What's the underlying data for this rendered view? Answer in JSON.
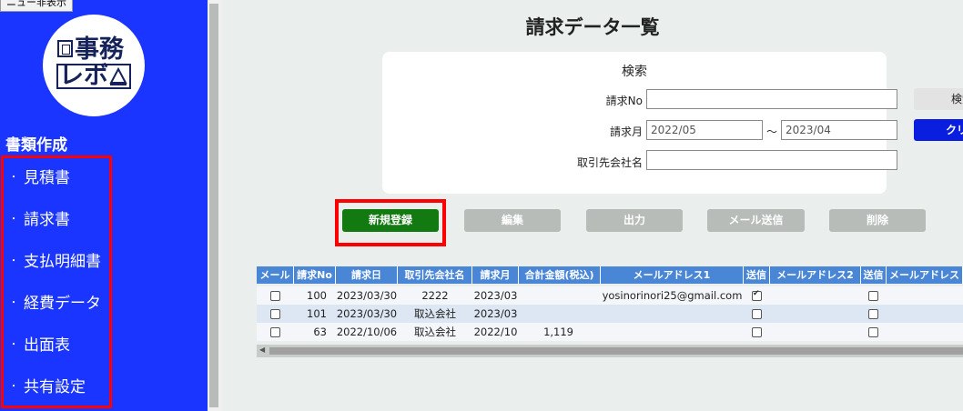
{
  "sidebar": {
    "menu_toggle": "ニュー非表示",
    "logo": {
      "row1": "事務",
      "row2": "レボ"
    },
    "section_title": "書類作成",
    "items": [
      {
        "label": "見積書"
      },
      {
        "label": "請求書"
      },
      {
        "label": "支払明細書"
      },
      {
        "label": "経費データ"
      },
      {
        "label": "出面表"
      },
      {
        "label": "共有設定"
      }
    ],
    "bullet": "・"
  },
  "main": {
    "title": "請求データ一覧",
    "search": {
      "title": "検索",
      "no_label": "請求No",
      "no_value": "",
      "month_label": "請求月",
      "month_from": "2022/05",
      "tilde": "～",
      "month_to": "2023/04",
      "company_label": "取引先会社名",
      "company_value": "",
      "search_button": "検索",
      "clear_button": "クリア"
    },
    "actions": {
      "new": "新規登録",
      "edit": "編集",
      "output": "出力",
      "mail": "メール送信",
      "delete": "削除"
    },
    "table": {
      "headers": [
        "メール",
        "請求No",
        "請求日",
        "取引先会社名",
        "請求月",
        "合計金額(税込)",
        "メールアドレス1",
        "送信",
        "メールアドレス2",
        "送信",
        "メールアドレス"
      ],
      "rows": [
        {
          "mail": false,
          "no": "100",
          "date": "2023/03/30",
          "company": "2222",
          "month": "2023/03",
          "total": "",
          "email1": "yosinorinori25@gmail.com",
          "sent1": true,
          "email2": "",
          "sent2": false
        },
        {
          "mail": false,
          "no": "101",
          "date": "2023/03/30",
          "company": "取込会社",
          "month": "2023/03",
          "total": "",
          "email1": "",
          "sent1": false,
          "email2": "",
          "sent2": false
        },
        {
          "mail": false,
          "no": "63",
          "date": "2022/10/06",
          "company": "取込会社",
          "month": "2022/10",
          "total": "1,119",
          "email1": "",
          "sent1": false,
          "email2": "",
          "sent2": false
        }
      ]
    }
  },
  "colors": {
    "sidebar_bg": "#1a35ff",
    "highlight": "#ff0000",
    "new_button": "#137a12",
    "clear_button": "#0a1ee0",
    "header_bg": "#4a86d6",
    "disabled_button": "#b7bcb8"
  }
}
